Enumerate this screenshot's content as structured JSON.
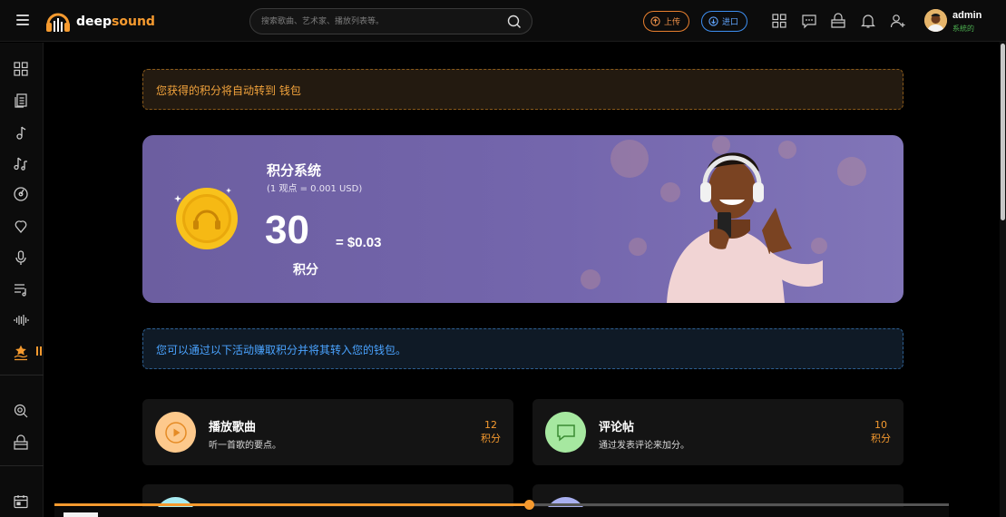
{
  "header": {
    "logo": {
      "part1": "deep",
      "part2": "sound"
    },
    "search_placeholder": "搜索歌曲、艺术家、播放列表等。",
    "upload_label": "上传",
    "import_label": "进口",
    "user": {
      "name": "admin",
      "status": "系統的"
    },
    "icons": [
      "menu-icon",
      "search-icon",
      "upload-icon",
      "import-icon",
      "apps-icon",
      "chat-icon",
      "store-icon",
      "bell-icon",
      "add-user-icon"
    ]
  },
  "sidebar": {
    "icons": [
      "grid-icon",
      "copy-icon",
      "music-note-icon",
      "music-notes-icon",
      "disc-icon",
      "heart-icon",
      "microphone-icon",
      "playlist-icon",
      "waveform-icon",
      "points-icon",
      "search-globe-icon",
      "bag-icon",
      "calendar-icon"
    ]
  },
  "notice_wallet": "您获得的积分将自动转到 钱包",
  "hero": {
    "title": "积分系统",
    "subtitle": "(1 观点 = 0.001 USD)",
    "points": "30",
    "usd": "= $0.03",
    "unit": "积分"
  },
  "notice_earn": "您可以通过以下活动赚取积分并将其转入您的钱包。",
  "activities": [
    {
      "title": "播放歌曲",
      "desc": "听一首歌的要点。",
      "points": "12",
      "unit": "积分",
      "color": "#fdc98c",
      "icon": "play-icon"
    },
    {
      "title": "评论帖",
      "desc": "通过发表评论来加分。",
      "points": "10",
      "unit": "积分",
      "color": "#a6e8a0",
      "icon": "comment-icon"
    }
  ],
  "colors": {
    "accent": "#f59a2f",
    "info": "#4aa3ff",
    "hero": "#7466ad",
    "card": "#141414"
  },
  "player": {
    "progress": 0.53
  }
}
